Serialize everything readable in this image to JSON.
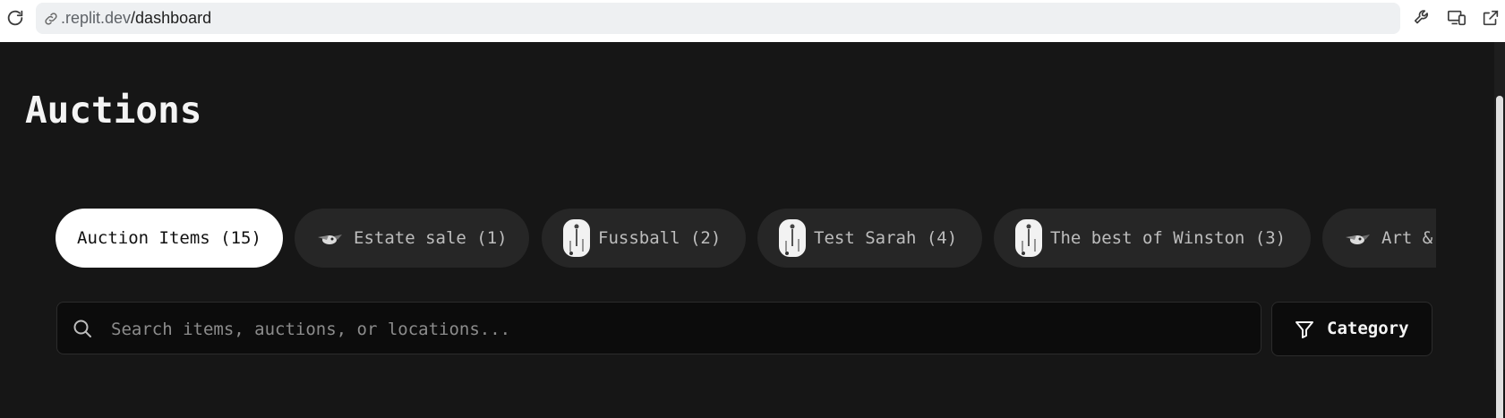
{
  "browser": {
    "url_host": ".replit.dev",
    "url_path": "/dashboard",
    "icons": [
      "reload-icon",
      "link-icon",
      "wrench-icon",
      "devices-icon",
      "open-external-icon"
    ]
  },
  "page": {
    "title": "Auctions"
  },
  "tabs": [
    {
      "label": "Auction Items (15)",
      "thumb": "none",
      "active": true
    },
    {
      "label": "Estate sale (1)",
      "thumb": "bird-icon",
      "active": false
    },
    {
      "label": "Fussball (2)",
      "thumb": "figure-image",
      "active": false
    },
    {
      "label": "Test Sarah (4)",
      "thumb": "figure-image",
      "active": false
    },
    {
      "label": "The best of Winston (3)",
      "thumb": "figure-image",
      "active": false
    },
    {
      "label": "Art &",
      "thumb": "bird-icon",
      "active": false
    }
  ],
  "search": {
    "placeholder": "Search items, auctions, or locations...",
    "value": ""
  },
  "filter": {
    "label": "Category",
    "icon": "filter-icon"
  },
  "colors": {
    "page_bg": "#161616",
    "tab_bg": "#262626",
    "tab_active_bg": "#ffffff",
    "input_bg": "#0c0c0c"
  }
}
